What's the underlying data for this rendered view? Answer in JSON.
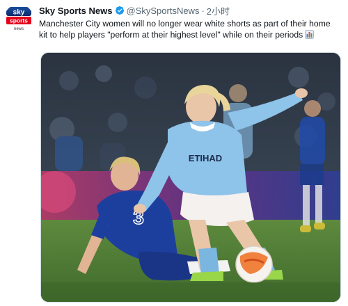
{
  "tweet": {
    "author": {
      "display_name": "Sky Sports News",
      "handle": "@SkySportsNews",
      "verified": true,
      "avatar_logo_top": "sky",
      "avatar_logo_mid": "sports",
      "avatar_logo_bottom": "news"
    },
    "separator": "·",
    "time": "2小时",
    "text": "Manchester City women will no longer wear white shorts as part of their home kit to help players \"perform at their highest level\" while on their periods",
    "text_emoji": "bar-chart-icon",
    "media": {
      "jersey_sponsor": "ETIHAD",
      "jersey_number": "3"
    }
  },
  "colors": {
    "verified_blue": "#1d9bf0",
    "sky_red": "#e2001a",
    "text_primary": "#0f1419",
    "text_secondary": "#536471"
  }
}
